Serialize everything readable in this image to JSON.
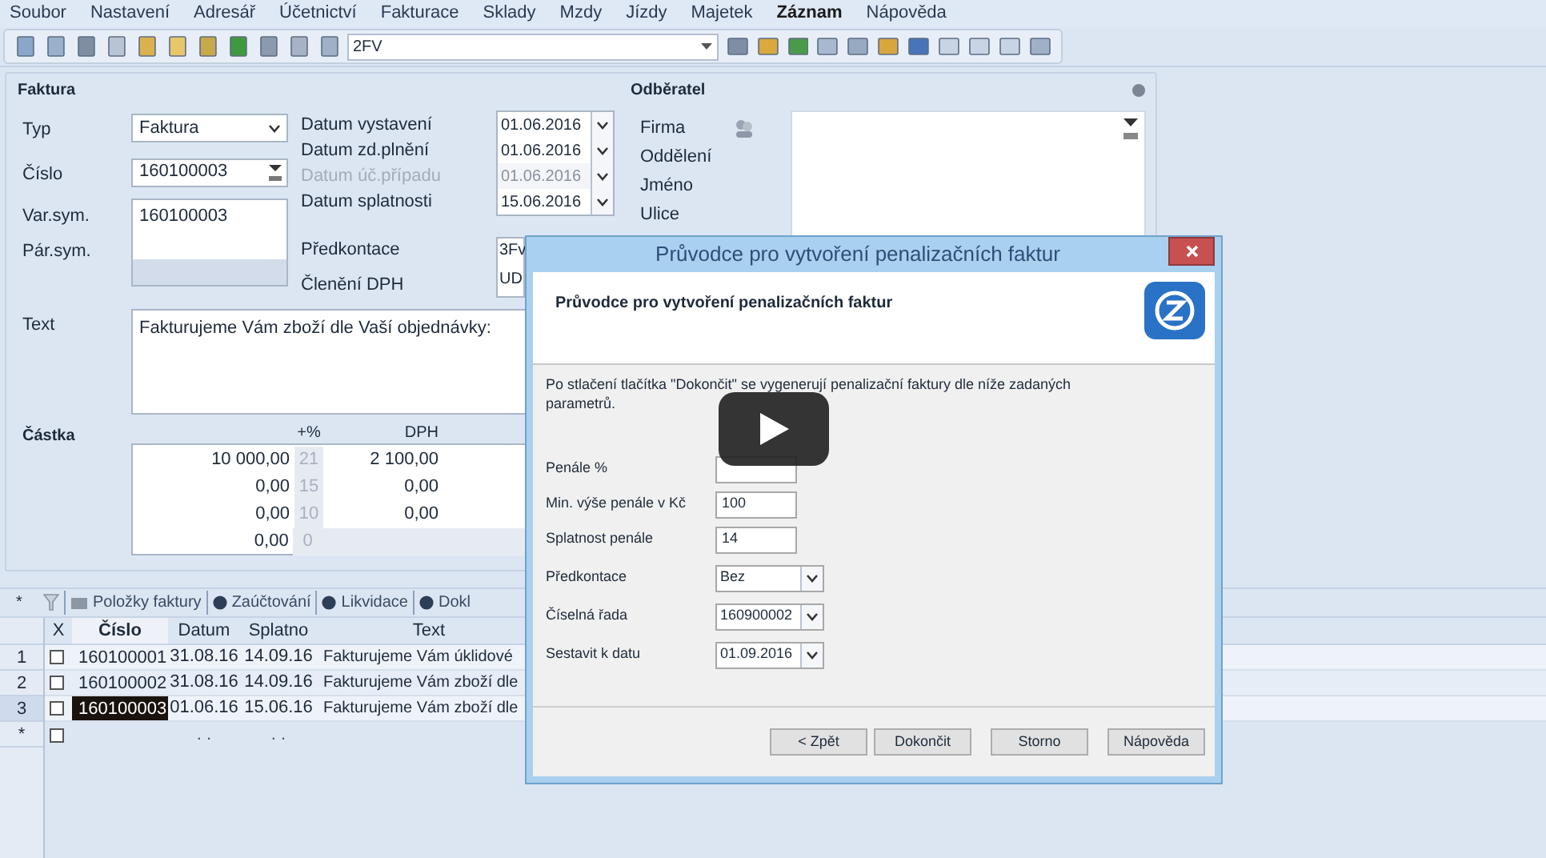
{
  "menu": [
    {
      "label": "Soubor",
      "selected": false
    },
    {
      "label": "Nastavení",
      "selected": false
    },
    {
      "label": "Adresář",
      "selected": false
    },
    {
      "label": "Účetnictví",
      "selected": false
    },
    {
      "label": "Fakturace",
      "selected": false
    },
    {
      "label": "Sklady",
      "selected": false
    },
    {
      "label": "Mzdy",
      "selected": false
    },
    {
      "label": "Jízdy",
      "selected": false
    },
    {
      "label": "Majetek",
      "selected": false
    },
    {
      "label": "Záznam",
      "selected": true
    },
    {
      "label": "Nápověda",
      "selected": false
    }
  ],
  "toolbar": {
    "combo_value": "2FV"
  },
  "faktura": {
    "title": "Faktura",
    "typ": {
      "label": "Typ",
      "value": "Faktura"
    },
    "cislo": {
      "label": "Číslo",
      "value": "160100003"
    },
    "var_sym": {
      "label": "Var.sym.",
      "value": "160100003"
    },
    "par_sym": {
      "label": "Pár.sym."
    },
    "dates": [
      {
        "label": "Datum vystavení",
        "value": "01.06.2016",
        "disabled": false
      },
      {
        "label": "Datum zd.plnění",
        "value": "01.06.2016",
        "disabled": false
      },
      {
        "label": "Datum úč.případu",
        "value": "01.06.2016",
        "disabled": true
      },
      {
        "label": "Datum splatnosti",
        "value": "15.06.2016",
        "disabled": false
      }
    ],
    "predkontace": {
      "label": "Předkontace",
      "value": "3Fv"
    },
    "cleneni": {
      "label": "Členění DPH",
      "value": "UD"
    },
    "text": {
      "label": "Text",
      "value": "Fakturujeme Vám zboží dle Vaší objednávky:"
    },
    "castka": {
      "label": "Částka",
      "rate_header": "+%",
      "vat_header": "DPH",
      "rows": [
        {
          "amount": "10 000,00",
          "rate": "21",
          "vat": "2 100,00"
        },
        {
          "amount": "0,00",
          "rate": "15",
          "vat": "0,00"
        },
        {
          "amount": "0,00",
          "rate": "10",
          "vat": "0,00"
        },
        {
          "amount": "0,00",
          "rate": "0"
        }
      ]
    }
  },
  "odberatel": {
    "title": "Odběratel",
    "labels": [
      "Firma",
      "Oddělení",
      "Jméno",
      "Ulice"
    ]
  },
  "tabs": [
    {
      "label": "Položky faktury"
    },
    {
      "label": "Zaúčtování"
    },
    {
      "label": "Likvidace"
    },
    {
      "label": "Dokl"
    }
  ],
  "grid": {
    "columns": [
      "X",
      "Číslo",
      "Datum",
      "Splatno",
      "Text"
    ],
    "rows": [
      {
        "number": "1",
        "checked": false,
        "selected": false,
        "cislo": "160100001",
        "datum": "31.08.16",
        "splatno": "14.09.16",
        "text": "Fakturujeme Vám úklidové"
      },
      {
        "number": "2",
        "checked": false,
        "selected": false,
        "cislo": "160100002",
        "datum": "31.08.16",
        "splatno": "14.09.16",
        "text": "Fakturujeme Vám zboží dle"
      },
      {
        "number": "3",
        "checked": false,
        "selected": true,
        "cislo": "160100003",
        "datum": "01.06.16",
        "splatno": "15.06.16",
        "text": "Fakturujeme Vám zboží dle"
      }
    ],
    "new_row": {
      "marker": "*",
      "checked": false,
      "datum": ". .",
      "splatno": ". ."
    }
  },
  "dialog": {
    "title": "Průvodce pro vytvoření penalizačních faktur",
    "heading": "Průvodce pro vytvoření penalizačních faktur",
    "description": "Po stlačení tlačítka \"Dokončit\" se vygenerují penalizační faktury dle níže zadaných parametrů.",
    "fields": [
      {
        "label": "Penále %",
        "kind": "text"
      },
      {
        "label": "Min. výše penále v Kč",
        "value": "100",
        "kind": "text"
      },
      {
        "label": "Splatnost penále",
        "value": "14",
        "kind": "text"
      },
      {
        "label": "Předkontace",
        "value": "Bez",
        "kind": "dropdown"
      },
      {
        "label": "Číselná řada",
        "value": "160900002",
        "kind": "dropdown"
      },
      {
        "label": "Sestavit k datu",
        "value": "01.09.2016",
        "kind": "dropdown"
      }
    ],
    "buttons": [
      "< Zpět",
      "Dokončit",
      "Storno",
      "Nápověda"
    ]
  }
}
